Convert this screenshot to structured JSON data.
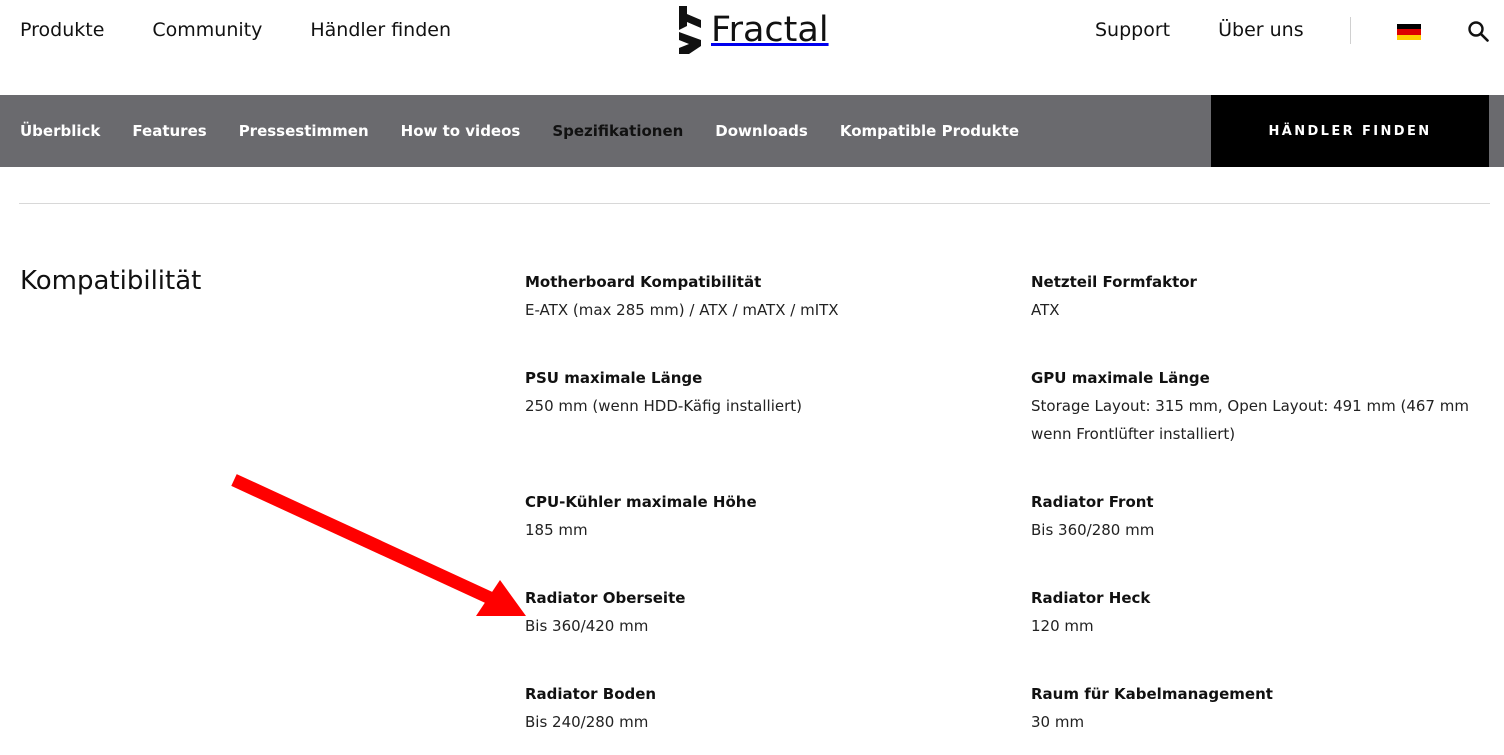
{
  "header": {
    "nav_left": [
      "Produkte",
      "Community",
      "Händler finden"
    ],
    "logo_text": "Fractal",
    "nav_right": [
      "Support",
      "Über uns"
    ],
    "flag_colors": [
      "#000000",
      "#DD0000",
      "#FFCE00"
    ]
  },
  "subnav": {
    "items": [
      "Überblick",
      "Features",
      "Pressestimmen",
      "How to videos",
      "Spezifikationen",
      "Downloads",
      "Kompatible Produkte"
    ],
    "active": "Spezifikationen",
    "cta": "HÄNDLER FINDEN"
  },
  "section": {
    "title": "Kompatibilität",
    "specs": [
      {
        "label": "Motherboard Kompatibilität",
        "value": "E-ATX (max 285 mm) / ATX / mATX / mITX"
      },
      {
        "label": "Netzteil Formfaktor",
        "value": "ATX"
      },
      {
        "label": "PSU maximale Länge",
        "value": "250 mm (wenn HDD-Käfig installiert)"
      },
      {
        "label": "GPU maximale Länge",
        "value": "Storage Layout: 315 mm, Open Layout: 491 mm (467 mm wenn Frontlüfter installiert)"
      },
      {
        "label": "CPU-Kühler maximale Höhe",
        "value": "185 mm"
      },
      {
        "label": "Radiator Front",
        "value": "Bis 360/280 mm"
      },
      {
        "label": "Radiator Oberseite",
        "value": "Bis 360/420 mm"
      },
      {
        "label": "Radiator Heck",
        "value": "120 mm"
      },
      {
        "label": "Radiator Boden",
        "value": "Bis 240/280 mm"
      },
      {
        "label": "Raum für Kabelmanagement",
        "value": "30 mm"
      }
    ]
  },
  "annotation": {
    "arrow_color": "#ff0000"
  }
}
